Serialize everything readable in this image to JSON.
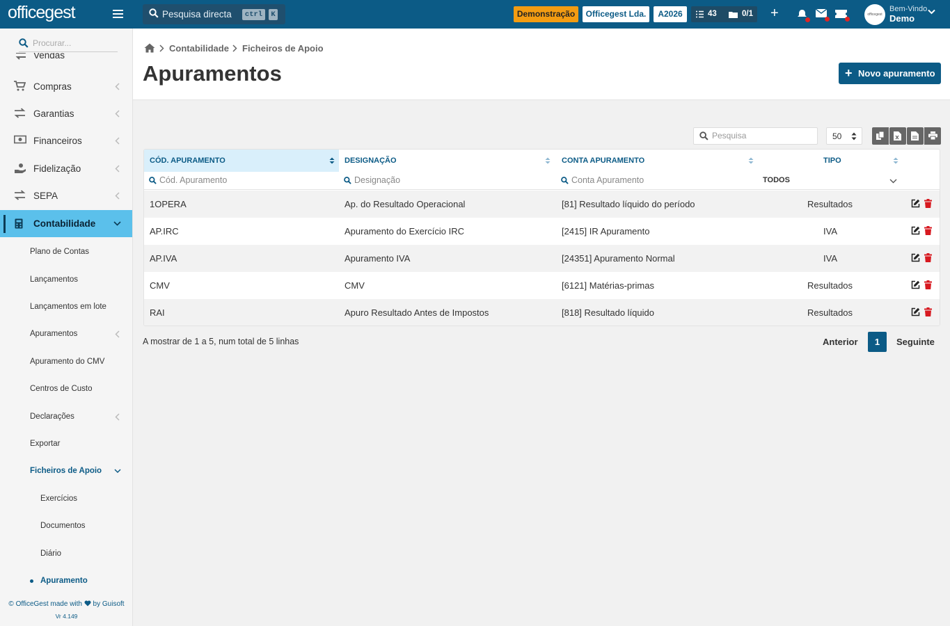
{
  "topbar": {
    "logo": "officegest",
    "search_label": "Pesquisa directa",
    "kbd_ctrl": "ctrl",
    "kbd_k": "K",
    "badge_demo": "Demonstração",
    "company": "Officegest Lda.",
    "year": "A2026",
    "tasks_count": "43",
    "folders_count": "0/1",
    "welcome": "Bem-Vindo",
    "user": "Demo",
    "accent": "#0c5b86",
    "demo_color": "#f39c12"
  },
  "sidebar": {
    "search_placeholder": "Procurar...",
    "cut_item": "Vendas",
    "items": [
      {
        "label": "Compras",
        "icon": "cart-icon"
      },
      {
        "label": "Garantias",
        "icon": "exchange-icon"
      },
      {
        "label": "Financeiros",
        "icon": "money-icon"
      },
      {
        "label": "Fidelização",
        "icon": "hand-holding-icon"
      },
      {
        "label": "SEPA",
        "icon": "exchange-icon"
      },
      {
        "label": "Contabilidade",
        "icon": "calculator-icon"
      }
    ],
    "sub_items": [
      {
        "label": "Plano de Contas"
      },
      {
        "label": "Lançamentos"
      },
      {
        "label": "Lançamentos em lote"
      },
      {
        "label": "Apuramentos"
      },
      {
        "label": "Apuramento do CMV"
      },
      {
        "label": "Centros de Custo"
      },
      {
        "label": "Declarações"
      },
      {
        "label": "Exportar"
      },
      {
        "label": "Ficheiros de Apoio"
      }
    ],
    "sub_sub_items": [
      {
        "label": "Exercícios"
      },
      {
        "label": "Documentos"
      },
      {
        "label": "Diário"
      },
      {
        "label": "Apuramento"
      }
    ],
    "footer_prefix": "© OfficeGest made with",
    "footer_suffix": "by Guisoft",
    "version": "Vr 4.149"
  },
  "page": {
    "breadcrumb": [
      "Contabilidade",
      "Ficheiros de Apoio"
    ],
    "title": "Apuramentos",
    "new_button": "Novo apuramento",
    "search_placeholder": "Pesquisa",
    "page_size": "50"
  },
  "table": {
    "columns": [
      "CÓD. APURAMENTO",
      "DESIGNAÇÃO",
      "CONTA APURAMENTO",
      "TIPO"
    ],
    "filters": [
      "Cód. Apuramento",
      "Designação",
      "Conta Apuramento"
    ],
    "tipo_filter": "TODOS",
    "rows": [
      {
        "cod": "1OPERA",
        "designacao": "Ap. do Resultado Operacional",
        "conta": "[81] Resultado líquido do período",
        "tipo": "Resultados"
      },
      {
        "cod": "AP.IRC",
        "designacao": "Apuramento do Exercício IRC",
        "conta": "[2415] IR Apuramento",
        "tipo": "IVA"
      },
      {
        "cod": "AP.IVA",
        "designacao": "Apuramento IVA",
        "conta": "[24351] Apuramento Normal",
        "tipo": "IVA"
      },
      {
        "cod": "CMV",
        "designacao": "CMV",
        "conta": "[6121] Matérias-primas",
        "tipo": "Resultados"
      },
      {
        "cod": "RAI",
        "designacao": "Apuro Resultado Antes de Impostos",
        "conta": "[818] Resultado líquido",
        "tipo": "Resultados"
      }
    ]
  },
  "pagination": {
    "info": "A mostrar de 1 a 5, num total de 5 linhas",
    "prev": "Anterior",
    "current": "1",
    "next": "Seguinte"
  }
}
